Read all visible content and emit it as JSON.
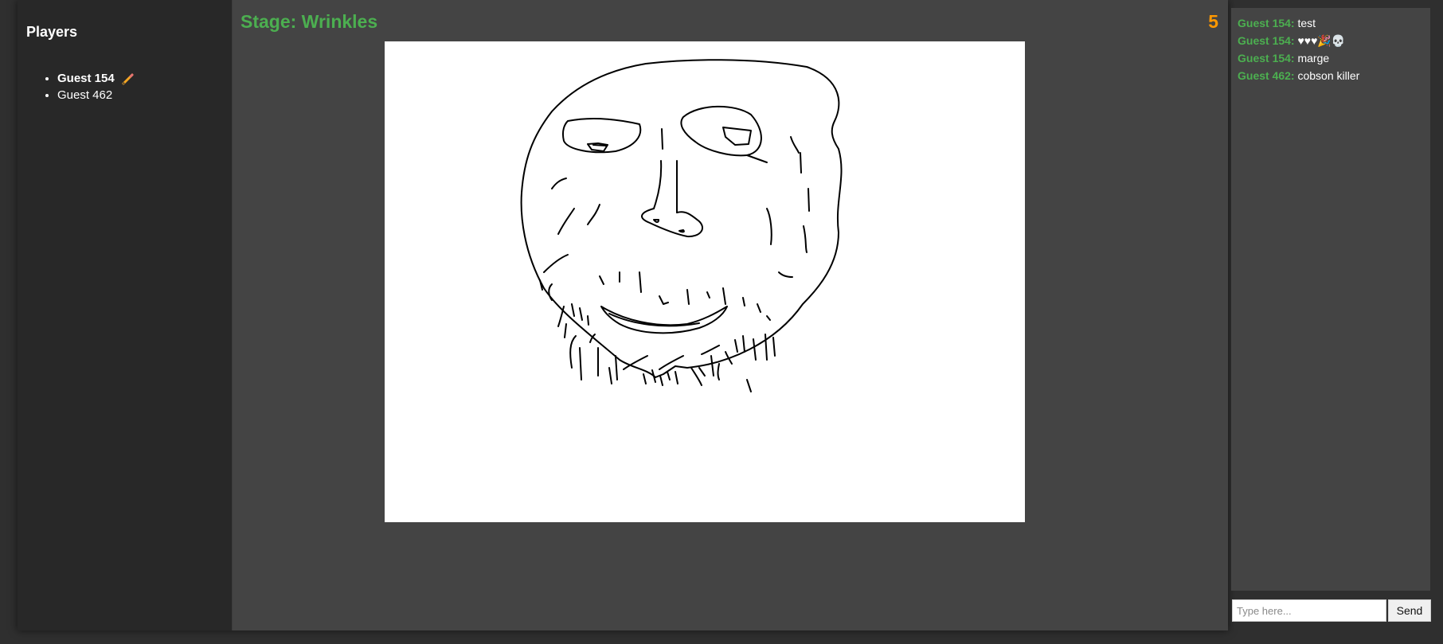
{
  "sidebar": {
    "title": "Players",
    "players": [
      {
        "name": "Guest 154",
        "drawing": true,
        "icon": "pencil-icon"
      },
      {
        "name": "Guest 462",
        "drawing": false
      }
    ]
  },
  "game": {
    "stage_label": "Stage: Wrinkles",
    "timer": "5"
  },
  "chat": {
    "messages": [
      {
        "user": "Guest 154:",
        "text": "test"
      },
      {
        "user": "Guest 154:",
        "text": "♥♥♥🎉💀"
      },
      {
        "user": "Guest 154:",
        "text": "marge"
      },
      {
        "user": "Guest 462:",
        "text": "cobson killer"
      }
    ],
    "input_placeholder": "Type here...",
    "send_label": "Send"
  },
  "colors": {
    "accent_green": "#4caf50",
    "timer_orange": "#ff9800",
    "sidebar_bg": "#282828",
    "main_bg": "#444444"
  }
}
